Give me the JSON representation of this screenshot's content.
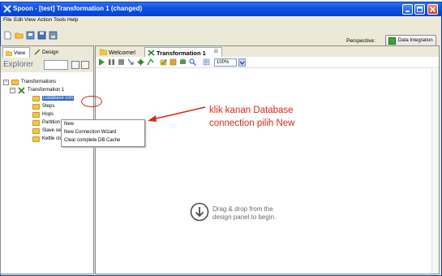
{
  "window": {
    "title": "Spoon - [test] Transformation 1 (changed)"
  },
  "menubar": {
    "items": [
      "File",
      "Edit",
      "View",
      "Action",
      "Tools",
      "Help"
    ]
  },
  "toolbar": {
    "perspective_label": "Perspective:",
    "perspective_value": "Data Integration"
  },
  "left_panel": {
    "tabs": [
      "View",
      "Design"
    ],
    "explorer_label": "Explorer",
    "tree": {
      "root": "Transformations",
      "transformation": "Transformation 1",
      "children": [
        "Database con",
        "Steps",
        "Hops",
        "Partition sche",
        "Slave server",
        "Kettle cluster schema"
      ]
    }
  },
  "context_menu": {
    "items": [
      "New",
      "New Connection Wizard",
      "Clear complete DB Cache"
    ]
  },
  "editor": {
    "tabs": [
      {
        "label": "Welcome!"
      },
      {
        "label": "Transformation 1",
        "close": "☒"
      }
    ],
    "zoom": "100%",
    "drag_line1": "Drag & drop from the",
    "drag_line2": "design panel to begin."
  },
  "annotation": {
    "line1": "klik kanan Database",
    "line2": "connection pilih New",
    "color": "#d42a1a"
  }
}
